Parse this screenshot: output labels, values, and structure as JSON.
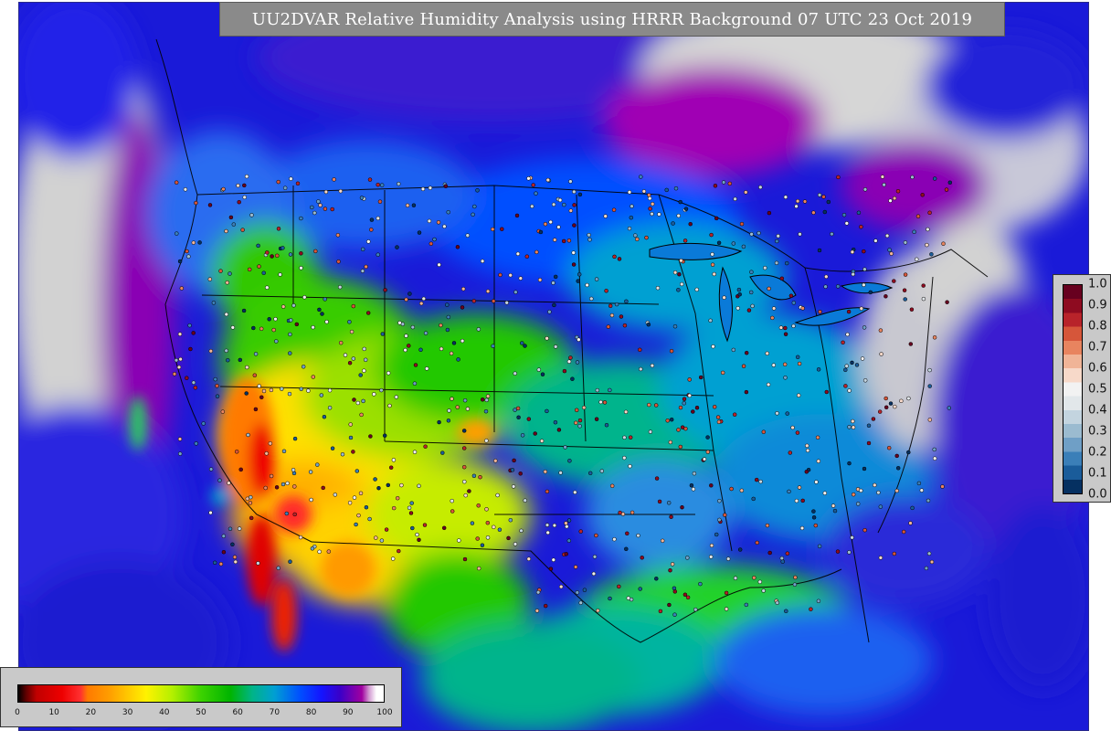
{
  "title": "UU2DVAR Relative Humidity Analysis using HRRR Background 07 UTC 23 Oct 2019",
  "colors": {
    "land_gray": "#d2d2d2",
    "title_bg": "#8a8a8a",
    "map_border": "#2a2a8a"
  },
  "horizontal_colorbar": {
    "tick_labels": [
      "0",
      "10",
      "20",
      "30",
      "40",
      "50",
      "60",
      "70",
      "80",
      "90",
      "100"
    ],
    "min": 0,
    "max": 100,
    "stops": [
      {
        "v": 0,
        "c": "#000000"
      },
      {
        "v": 2,
        "c": "#5a0000"
      },
      {
        "v": 5,
        "c": "#c00000"
      },
      {
        "v": 12,
        "c": "#ee0000"
      },
      {
        "v": 17,
        "c": "#ff3030"
      },
      {
        "v": 19,
        "c": "#ff7a00"
      },
      {
        "v": 25,
        "c": "#ff9e00"
      },
      {
        "v": 30,
        "c": "#ffc800"
      },
      {
        "v": 35,
        "c": "#fff200"
      },
      {
        "v": 42,
        "c": "#b5f000"
      },
      {
        "v": 50,
        "c": "#3cd200"
      },
      {
        "v": 58,
        "c": "#00b400"
      },
      {
        "v": 64,
        "c": "#00b487"
      },
      {
        "v": 70,
        "c": "#00a0d2"
      },
      {
        "v": 77,
        "c": "#0050ff"
      },
      {
        "v": 83,
        "c": "#1414ff"
      },
      {
        "v": 88,
        "c": "#3a00c8"
      },
      {
        "v": 91,
        "c": "#6e00b4"
      },
      {
        "v": 94,
        "c": "#a000a0"
      },
      {
        "v": 96,
        "c": "#d29bd2"
      },
      {
        "v": 98,
        "c": "#ffffff"
      },
      {
        "v": 100,
        "c": "#ffffff"
      }
    ]
  },
  "vertical_colorbar": {
    "tick_labels": [
      "0.0",
      "0.1",
      "0.2",
      "0.3",
      "0.4",
      "0.5",
      "0.6",
      "0.7",
      "0.8",
      "0.9",
      "1.0"
    ],
    "colors": [
      "#053061",
      "#1a5c9a",
      "#3b7fb8",
      "#6f9fc6",
      "#9bbbd0",
      "#c3d4df",
      "#e2e7ea",
      "#f2f2f2",
      "#f7d9c9",
      "#f0b497",
      "#e8845f",
      "#d6563a",
      "#b8232a",
      "#8e0b20",
      "#67001f"
    ]
  }
}
